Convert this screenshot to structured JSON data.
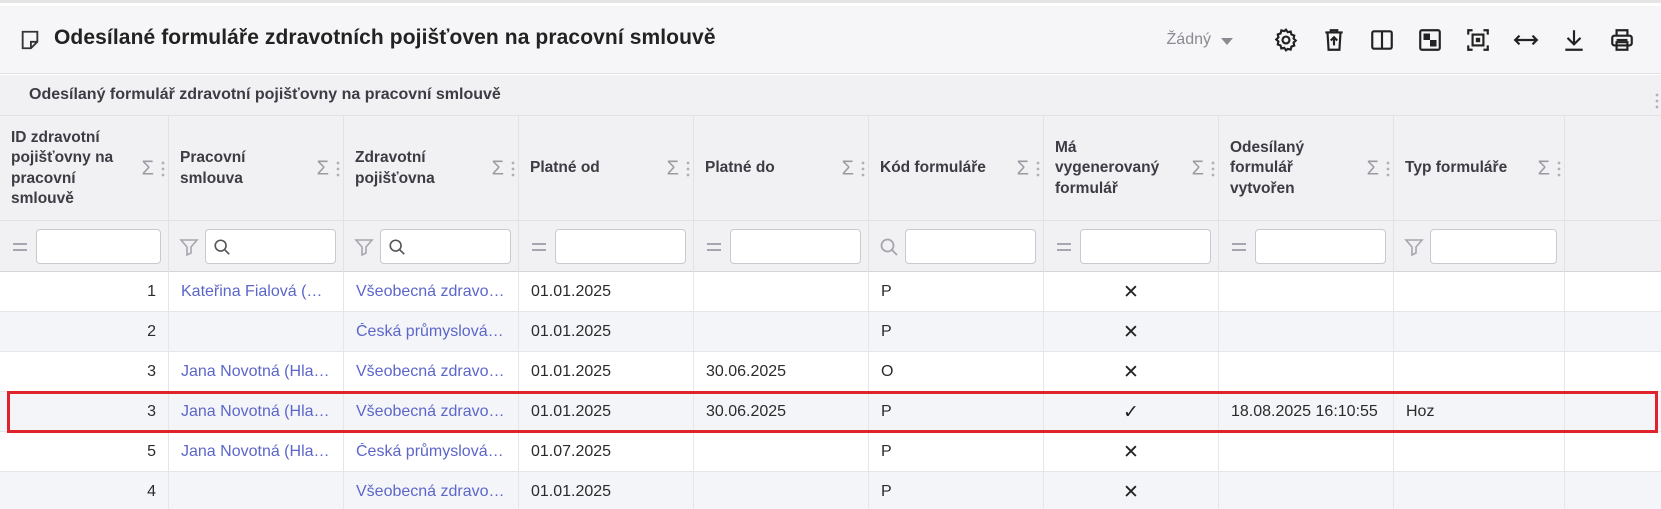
{
  "header": {
    "title": "Odesílané formuláře zdravotních pojišťoven na pracovní smlouvě",
    "layout_select_value": "Žádný"
  },
  "toolbar": {
    "buttons": [
      {
        "name": "settings-button",
        "icon": "gear-icon"
      },
      {
        "name": "delete-button",
        "icon": "trash-upload-icon"
      },
      {
        "name": "split-view-button",
        "icon": "columns-icon"
      },
      {
        "name": "select-view-button",
        "icon": "checker-icon"
      },
      {
        "name": "fit-screen-button",
        "icon": "fit-icon"
      },
      {
        "name": "expand-width-button",
        "icon": "horizontal-arrows-icon"
      },
      {
        "name": "download-button",
        "icon": "download-icon"
      },
      {
        "name": "print-button",
        "icon": "printer-icon"
      }
    ]
  },
  "group": {
    "label": "Odesílaný formulář zdravotní pojišťovny na pracovní smlouvě"
  },
  "columns": [
    {
      "label": "ID zdravotní pojišťovny na pracovní smlouvě",
      "filter": "equals"
    },
    {
      "label": "Pracovní smlouva",
      "filter": "funnel-search"
    },
    {
      "label": "Zdravotní pojišťovna",
      "filter": "funnel-search"
    },
    {
      "label": "Platné od",
      "filter": "equals"
    },
    {
      "label": "Platné do",
      "filter": "equals"
    },
    {
      "label": "Kód formuláře",
      "filter": "search"
    },
    {
      "label": "Má vygenerovaný formulář",
      "filter": "equals"
    },
    {
      "label": "Odesílaný formulář vytvořen",
      "filter": "equals"
    },
    {
      "label": "Typ formuláře",
      "filter": "funnel"
    }
  ],
  "sigma_symbol": "Σ",
  "rows": [
    [
      "1",
      "Kateřina Fialová (Hl…",
      "Všeobecná zdravot…",
      "01.01.2025",
      "",
      "P",
      "✕",
      "",
      ""
    ],
    [
      "2",
      "",
      "Česká průmyslová …",
      "01.01.2025",
      "",
      "P",
      "✕",
      "",
      ""
    ],
    [
      "3",
      "Jana Novotná (Hla…",
      "Všeobecná zdravot…",
      "01.01.2025",
      "30.06.2025",
      "O",
      "✕",
      "",
      ""
    ],
    [
      "3",
      "Jana Novotná (Hla…",
      "Všeobecná zdravot…",
      "01.01.2025",
      "30.06.2025",
      "P",
      "✓",
      "18.08.2025 16:10:55",
      "Hoz"
    ],
    [
      "5",
      "Jana Novotná (Hla…",
      "Česká průmyslová …",
      "01.07.2025",
      "",
      "P",
      "✕",
      "",
      ""
    ],
    [
      "4",
      "",
      "Všeobecná zdravot…",
      "01.01.2025",
      "",
      "P",
      "✕",
      "",
      ""
    ]
  ],
  "highlighted_row_index": 3,
  "colors": {
    "link": "#5c66c9",
    "highlight": "#e0222a",
    "header_bg": "#f1f1f3"
  }
}
